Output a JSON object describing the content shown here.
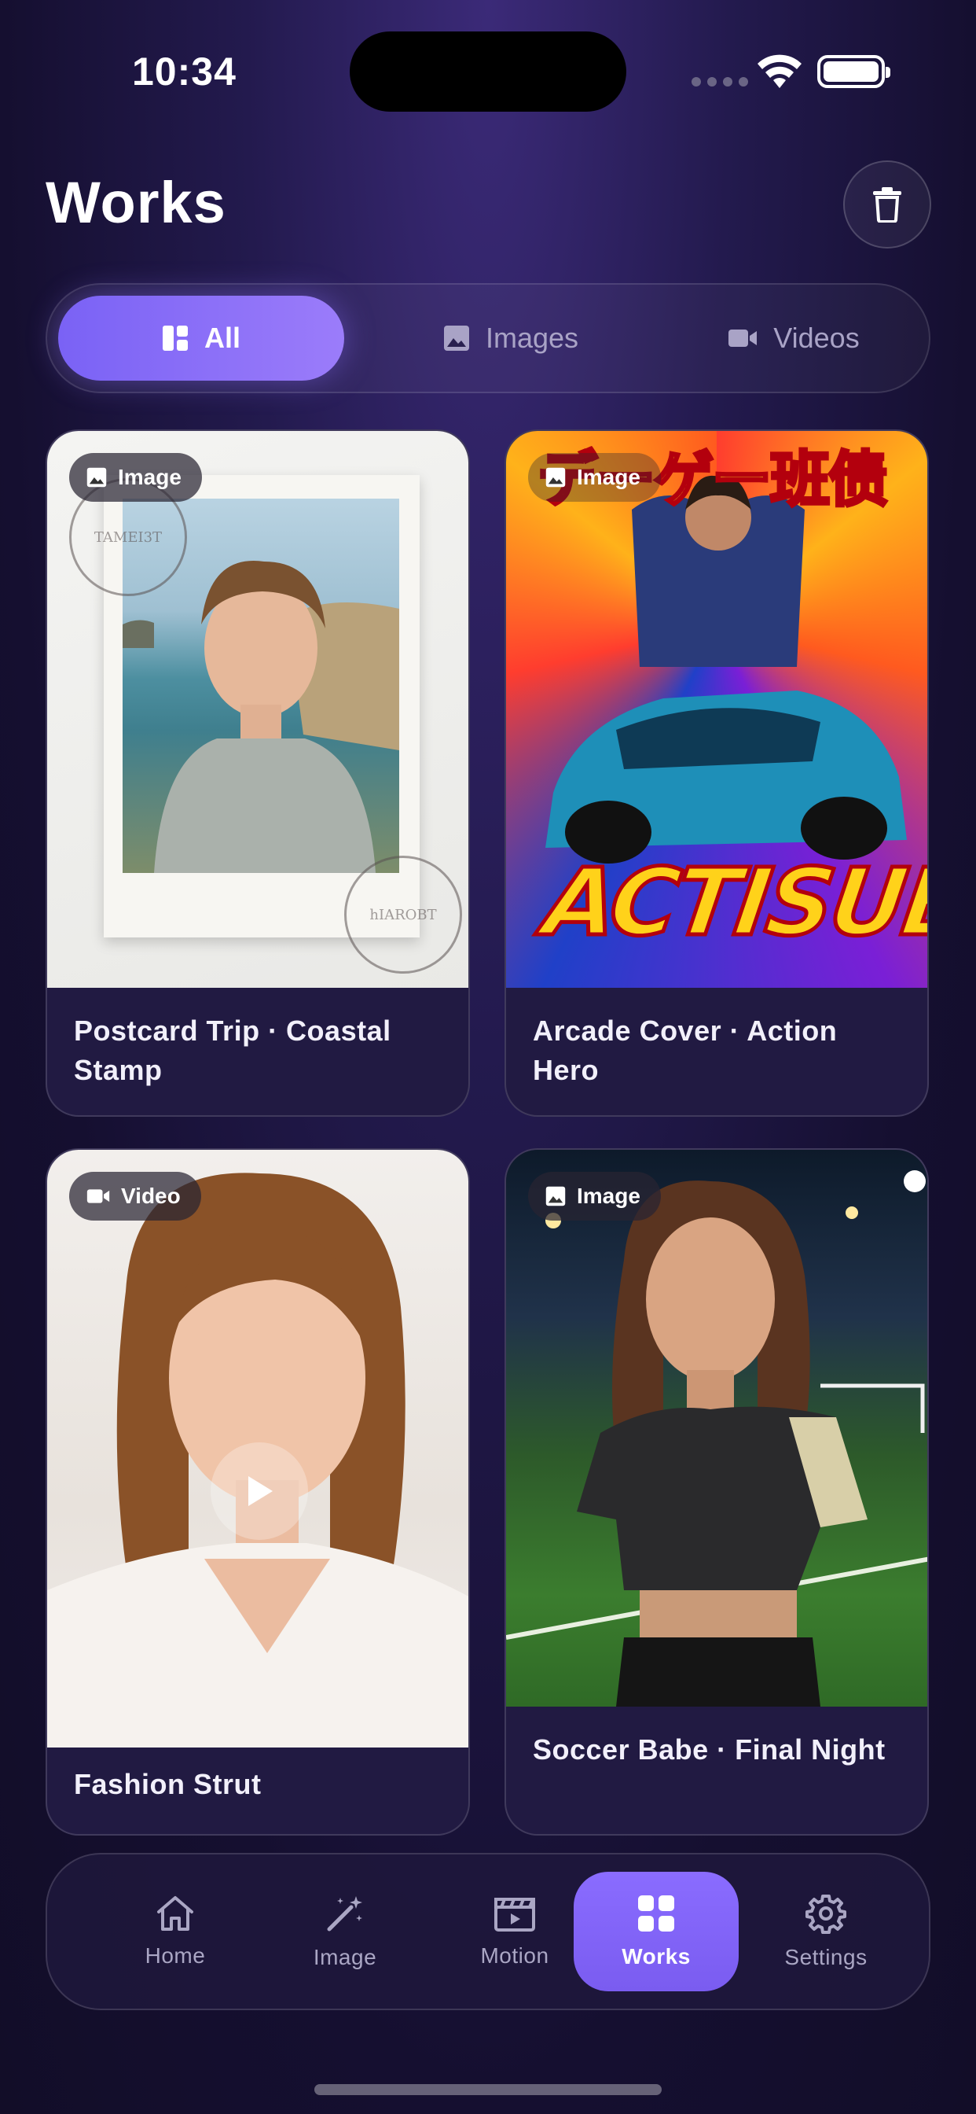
{
  "status": {
    "time": "10:34"
  },
  "header": {
    "title": "Works"
  },
  "filters": [
    {
      "label": "All",
      "active": true
    },
    {
      "label": "Images",
      "active": false
    },
    {
      "label": "Videos",
      "active": false
    }
  ],
  "cards": [
    {
      "badge": "Image",
      "title": "Postcard Trip · Coastal Stamp"
    },
    {
      "badge": "Image",
      "title": "Arcade Cover · Action Hero",
      "art_text_top": "デーゲー班债",
      "art_text_bottom": "ACTISUE"
    },
    {
      "badge": "Video",
      "title": "Fashion Strut"
    },
    {
      "badge": "Image",
      "title": "Soccer Babe · Final Night"
    }
  ],
  "tabs": [
    {
      "label": "Home",
      "icon": "home-icon"
    },
    {
      "label": "Image",
      "icon": "magic-wand-icon"
    },
    {
      "label": "Motion",
      "icon": "clapperboard-icon"
    },
    {
      "label": "Works",
      "icon": "grid-icon",
      "active": true
    },
    {
      "label": "Settings",
      "icon": "gear-icon"
    }
  ],
  "colors": {
    "accent": "#7a62f5",
    "background": "#1a1338"
  }
}
